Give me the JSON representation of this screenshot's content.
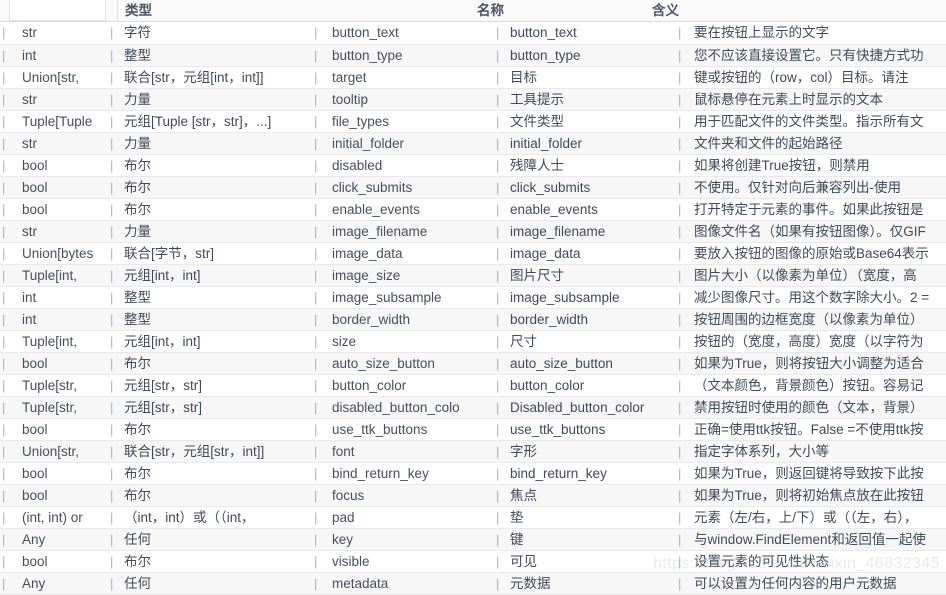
{
  "header": {
    "col_type": "类型",
    "col_name": "名称",
    "col_meaning": "含义",
    "sep": "|"
  },
  "watermark": "https://blog.csdn.net/weixin_46832345",
  "rows": [
    {
      "py_type": "str",
      "cn_type": "字符",
      "en_name": "button_text",
      "cn_name": "button_text",
      "meaning": "要在按钮上显示的文字"
    },
    {
      "py_type": "int",
      "cn_type": "整型",
      "en_name": "button_type",
      "cn_name": "button_type",
      "meaning": "您不应该直接设置它。只有快捷方式功"
    },
    {
      "py_type": "Union[str,",
      "cn_type": "联合[str，元组[int，int]]",
      "en_name": "target",
      "cn_name": "目标",
      "meaning": "键或按钮的（row，col）目标。请注"
    },
    {
      "py_type": "str",
      "cn_type": "力量",
      "en_name": "tooltip",
      "cn_name": "工具提示",
      "meaning": "鼠标悬停在元素上时显示的文本"
    },
    {
      "py_type": "Tuple[Tuple",
      "cn_type": "元组[Tuple [str，str]，...]",
      "en_name": "file_types",
      "cn_name": "文件类型",
      "meaning": "用于匹配文件的文件类型。指示所有文"
    },
    {
      "py_type": "str",
      "cn_type": "力量",
      "en_name": "initial_folder",
      "cn_name": "initial_folder",
      "meaning": "文件夹和文件的起始路径"
    },
    {
      "py_type": "bool",
      "cn_type": "布尔",
      "en_name": "disabled",
      "cn_name": "残障人士",
      "meaning": "如果将创建True按钮，则禁用"
    },
    {
      "py_type": "bool",
      "cn_type": "布尔",
      "en_name": "click_submits",
      "cn_name": "click_submits",
      "meaning": "不使用。仅针对向后兼容列出-使用"
    },
    {
      "py_type": "bool",
      "cn_type": "布尔",
      "en_name": "enable_events",
      "cn_name": "enable_events",
      "meaning": "打开特定于元素的事件。如果此按钮是"
    },
    {
      "py_type": "str",
      "cn_type": "力量",
      "en_name": "image_filename",
      "cn_name": "image_filename",
      "meaning": "图像文件名（如果有按钮图像）。仅GIF"
    },
    {
      "py_type": "Union[bytes",
      "cn_type": "联合[字节，str]",
      "en_name": "image_data",
      "cn_name": "image_data",
      "meaning": "要放入按钮的图像的原始或Base64表示"
    },
    {
      "py_type": "Tuple[int,",
      "cn_type": "元组[int，int]",
      "en_name": "image_size",
      "cn_name": "图片尺寸",
      "meaning": "图片大小（以像素为单位）（宽度，高"
    },
    {
      "py_type": "int",
      "cn_type": "整型",
      "en_name": "image_subsample",
      "cn_name": "image_subsample",
      "meaning": "减少图像尺寸。用这个数字除大小。2 ="
    },
    {
      "py_type": "int",
      "cn_type": "整型",
      "en_name": "border_width",
      "cn_name": "border_width",
      "meaning": "按钮周围的边框宽度（以像素为单位）"
    },
    {
      "py_type": "Tuple[int,",
      "cn_type": "元组[int，int]",
      "en_name": "size",
      "cn_name": "尺寸",
      "meaning": "按钮的（宽度，高度）宽度（以字符为"
    },
    {
      "py_type": "bool",
      "cn_type": "布尔",
      "en_name": "auto_size_button",
      "cn_name": "auto_size_button",
      "meaning": "如果为True，则将按钮大小调整为适合"
    },
    {
      "py_type": "Tuple[str,",
      "cn_type": "元组[str，str]",
      "en_name": "button_color",
      "cn_name": "button_color",
      "meaning": "（文本颜色，背景颜色）按钮。容易记"
    },
    {
      "py_type": "Tuple[str,",
      "cn_type": "元组[str，str]",
      "en_name": "disabled_button_colo",
      "cn_name": "Disabled_button_color",
      "meaning": "禁用按钮时使用的颜色（文本，背景）"
    },
    {
      "py_type": "bool",
      "cn_type": "布尔",
      "en_name": "use_ttk_buttons",
      "cn_name": "use_ttk_buttons",
      "meaning": "正确=使用ttk按钮。False =不使用ttk按"
    },
    {
      "py_type": "Union[str,",
      "cn_type": "联合[str，元组[str，int]]",
      "en_name": "font",
      "cn_name": "字形",
      "meaning": "指定字体系列，大小等"
    },
    {
      "py_type": "bool",
      "cn_type": "布尔",
      "en_name": "bind_return_key",
      "cn_name": "bind_return_key",
      "meaning": "如果为True，则返回键将导致按下此按"
    },
    {
      "py_type": "bool",
      "cn_type": "布尔",
      "en_name": "focus",
      "cn_name": "焦点",
      "meaning": "如果为True，则将初始焦点放在此按钮"
    },
    {
      "py_type": "(int, int) or",
      "cn_type": "（int，int）或（（int，",
      "en_name": "pad",
      "cn_name": "垫",
      "meaning": "元素（左/右，上/下）或（（左，右），"
    },
    {
      "py_type": "Any",
      "cn_type": "任何",
      "en_name": "key",
      "cn_name": "键",
      "meaning": "与window.FindElement和返回值一起使"
    },
    {
      "py_type": "bool",
      "cn_type": "布尔",
      "en_name": "visible",
      "cn_name": "可见",
      "meaning": "设置元素的可见性状态"
    },
    {
      "py_type": "Any",
      "cn_type": "任何",
      "en_name": "metadata",
      "cn_name": "元数据",
      "meaning": "可以设置为任何内容的用户元数据"
    }
  ]
}
